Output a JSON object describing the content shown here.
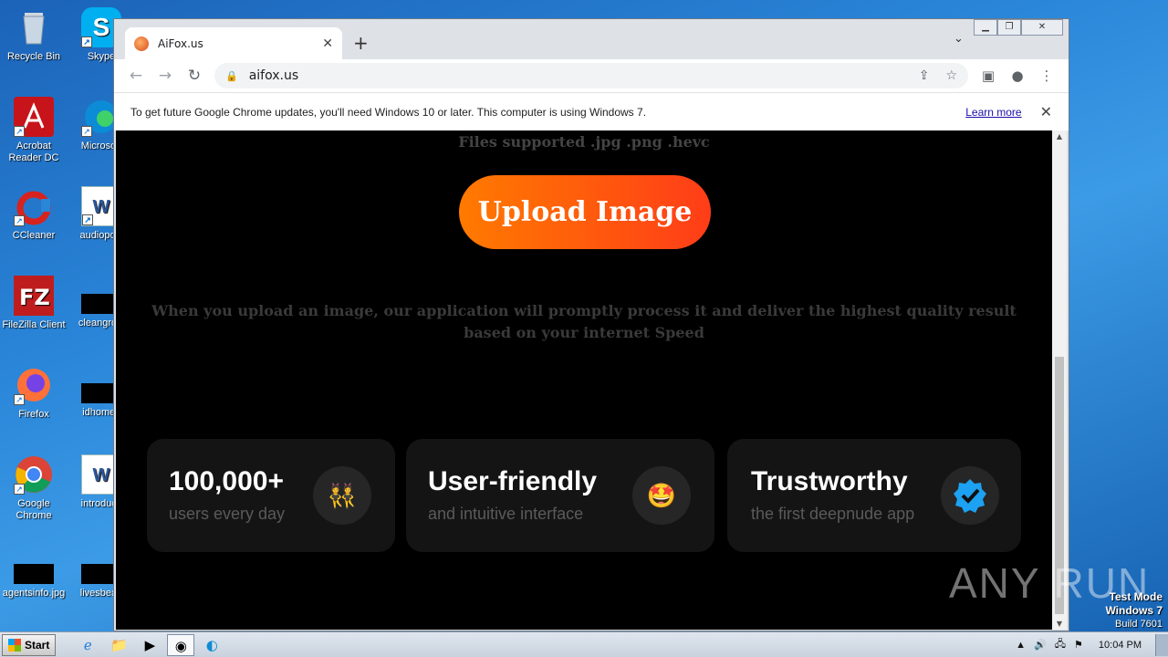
{
  "desktop": {
    "icons": [
      {
        "label": "Recycle Bin"
      },
      {
        "label": "Acrobat Reader DC"
      },
      {
        "label": "CCleaner"
      },
      {
        "label": "FileZilla Client"
      },
      {
        "label": "Firefox"
      },
      {
        "label": "Google Chrome"
      },
      {
        "label": "agentsinfo.jpg"
      },
      {
        "label": "Skype"
      },
      {
        "label": "Microsoft"
      },
      {
        "label": "audiopolit"
      },
      {
        "label": "cleangrow"
      },
      {
        "label": "idhomes"
      },
      {
        "label": "introducti"
      },
      {
        "label": "livesbead"
      }
    ]
  },
  "browser": {
    "tab_title": "AiFox.us",
    "url": "aifox.us",
    "infobar_message": "To get future Google Chrome updates, you'll need Windows 10 or later. This computer is using Windows 7.",
    "infobar_link": "Learn more"
  },
  "page": {
    "files_supported": "Files supported .jpg .png .hevc",
    "upload_button": "Upload Image",
    "description": "When you upload an image, our application will promptly process it and deliver the highest quality result based on your internet Speed",
    "cards": [
      {
        "title": "100,000+",
        "subtitle": "users every day",
        "icon": "people-emoji-icon"
      },
      {
        "title": "User-friendly",
        "subtitle": "and intuitive interface",
        "icon": "star-struck-emoji-icon"
      },
      {
        "title": "Trustworthy",
        "subtitle": "the first deepnude app",
        "icon": "verified-badge-icon"
      }
    ]
  },
  "overlay": {
    "watermark": "ANY RUN",
    "test_mode": "Test Mode",
    "os_name": "Windows 7",
    "build": "Build 7601"
  },
  "taskbar": {
    "start_label": "Start",
    "clock": "10:04 PM"
  }
}
